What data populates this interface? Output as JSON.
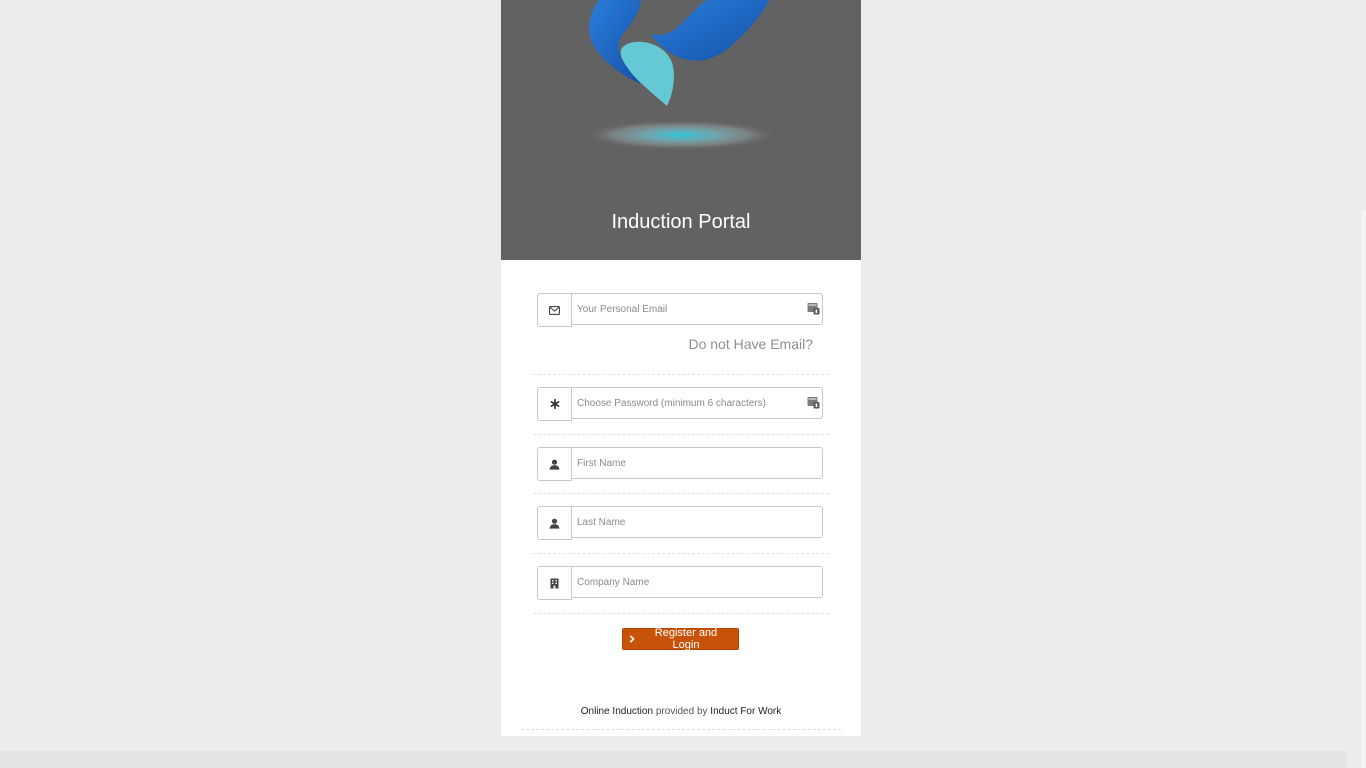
{
  "header": {
    "title": "Induction Portal"
  },
  "form": {
    "email": {
      "placeholder": "Your Personal Email",
      "value": ""
    },
    "no_email_link": "Do not Have Email?",
    "password": {
      "placeholder": "Choose Password (minimum 6 characters)",
      "value": ""
    },
    "first_name": {
      "placeholder": "First Name",
      "value": ""
    },
    "last_name": {
      "placeholder": "Last Name",
      "value": ""
    },
    "company": {
      "placeholder": "Company Name",
      "value": ""
    },
    "submit_label": "Register and Login"
  },
  "footer": {
    "prefix": "Online Induction",
    "middle": "provided by",
    "brand": "Induct For Work"
  },
  "icons": {
    "email": "envelope-icon",
    "password": "asterisk-icon",
    "first_name": "user-icon",
    "last_name": "user-icon",
    "company": "building-icon",
    "submit": "chevron-right-icon",
    "password_manager": "password-manager-icon"
  },
  "colors": {
    "hero_background": "#626262",
    "accent_button": "#c85308",
    "logo_dark_blue": "#1a5fb4",
    "logo_light_blue": "#5ecad6",
    "page_background": "#ececec"
  }
}
